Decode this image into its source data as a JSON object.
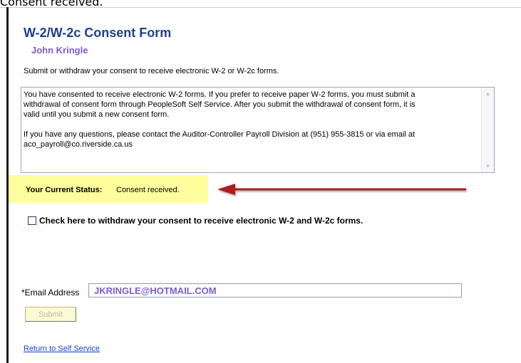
{
  "caption": "Consent received.",
  "form": {
    "title": "W-2/W-2c Consent Form",
    "user_name": "John Kringle",
    "instruction": "Submit or withdraw your consent to receive electronic W-2 or W-2c forms."
  },
  "notice": {
    "paragraph1_line1": "You have consented to receive electronic W-2 forms.  If you prefer to receive paper W-2 forms, you must submit a",
    "paragraph1_line2": "withdrawal of consent form through PeopleSoft Self Service.  After you submit the withdrawal of consent form, it is",
    "paragraph1_line3": "valid until you submit a new consent form.",
    "paragraph2_line1": "If you have any questions, please contact the Auditor-Controller Payroll Division at (951) 955-3815 or via email at",
    "paragraph2_line2": "aco_payroll@co.riverside.ca.us"
  },
  "status": {
    "label": "Your Current Status:",
    "value": "Consent received."
  },
  "withdraw": {
    "label": "Check here to withdraw your consent to receive electronic W-2 and W-2c forms.",
    "checked": false
  },
  "email": {
    "label": "*Email Address",
    "value": "JKRINGLE@HOTMAIL.COM"
  },
  "submit_label": "Submit",
  "return_link": "Return to Self Service",
  "colors": {
    "title": "#1f3f8c",
    "user_name": "#7d5bd0",
    "highlight": "#fefe9c",
    "arrow": "#b01c1c",
    "link": "#1a3fd6"
  },
  "icons": {
    "scroll_up": "up-triangle",
    "scroll_down": "down-triangle",
    "annotation_arrow": "left-arrow"
  }
}
